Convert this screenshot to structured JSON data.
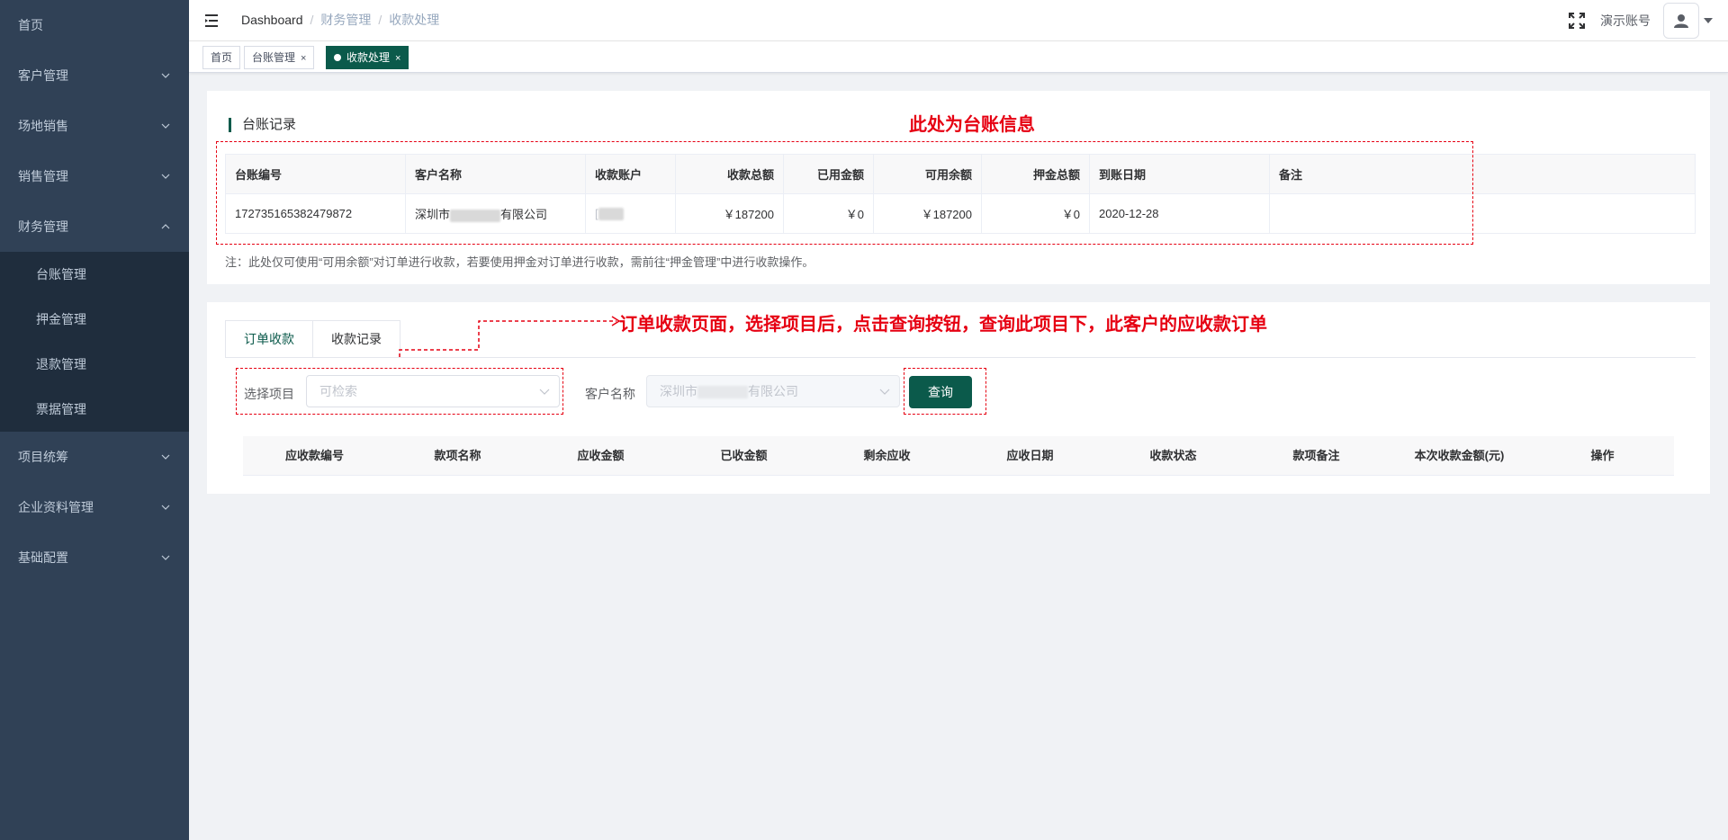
{
  "sidebar": {
    "items": [
      {
        "label": "首页",
        "has_arrow": false
      },
      {
        "label": "客户管理",
        "has_arrow": true
      },
      {
        "label": "场地销售",
        "has_arrow": true
      },
      {
        "label": "销售管理",
        "has_arrow": true
      },
      {
        "label": "财务管理",
        "has_arrow": true,
        "expanded": true
      },
      {
        "label": "项目统筹",
        "has_arrow": true
      },
      {
        "label": "企业资料管理",
        "has_arrow": true
      },
      {
        "label": "基础配置",
        "has_arrow": true
      }
    ],
    "finance_sub": [
      "台账管理",
      "押金管理",
      "退款管理",
      "票据管理"
    ]
  },
  "navbar": {
    "breadcrumb": [
      "Dashboard",
      "财务管理",
      "收款处理"
    ],
    "account_name": "演示账号",
    "icons": [
      "hamburger-icon",
      "fullscreen-icon",
      "user-icon",
      "caret-down-icon"
    ]
  },
  "tags": [
    {
      "label": "首页",
      "closable": false,
      "active": false
    },
    {
      "label": "台账管理",
      "closable": true,
      "active": false
    },
    {
      "label": "收款处理",
      "closable": true,
      "active": true
    }
  ],
  "ledger": {
    "title": "台账记录",
    "columns": [
      "台账编号",
      "客户名称",
      "收款账户",
      "收款总额",
      "已用金额",
      "可用余额",
      "押金总额",
      "到账日期",
      "备注"
    ],
    "row": {
      "id": "172735165382479872",
      "customer_prefix": "深圳市",
      "customer_suffix": "有限公司",
      "account_prefix": "[",
      "total": "￥187200",
      "used": "￥0",
      "available": "￥187200",
      "deposit": "￥0",
      "date": "2020-12-28",
      "remark": ""
    },
    "note": "注：此处仅可使用“可用余额”对订单进行收款，若要使用押金对订单进行收款，需前往“押金管理”中进行收款操作。"
  },
  "annotations": {
    "ledger_caption": "此处为台账信息",
    "order_caption": "订单收款页面，选择项目后，点击查询按钮，查询此项目下，此客户的应收款订单",
    "color": "#e60012"
  },
  "order": {
    "tabs": [
      "订单收款",
      "收款记录"
    ],
    "project_label": "选择项目",
    "project_placeholder": "可检索",
    "customer_label": "客户名称",
    "customer_value_prefix": "深圳市",
    "customer_value_suffix": "有限公司",
    "query_label": "查询",
    "columns": [
      "应收款编号",
      "款项名称",
      "应收金额",
      "已收金额",
      "剩余应收",
      "应收日期",
      "收款状态",
      "款项备注",
      "本次收款金额(元)",
      "操作"
    ]
  },
  "colors": {
    "sidebar_bg": "#304156",
    "submenu_bg": "#1f2d3d",
    "primary": "#0b5a4b"
  }
}
